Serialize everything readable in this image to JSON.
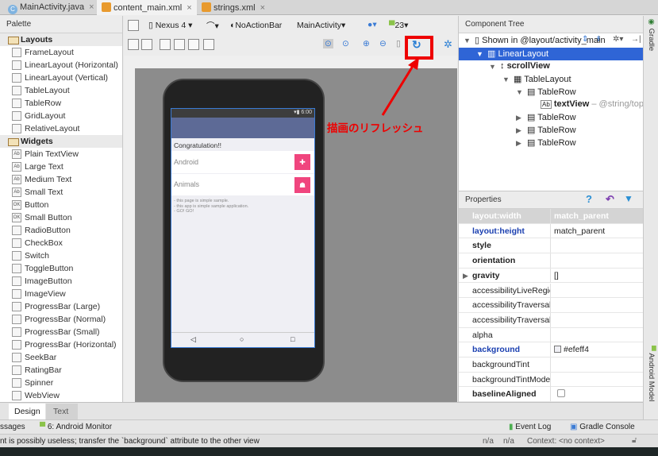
{
  "tabs": [
    {
      "label": "MainActivity.java",
      "icon": "C",
      "active": false
    },
    {
      "label": "content_main.xml",
      "icon": "xml",
      "active": true
    },
    {
      "label": "strings.xml",
      "icon": "xml",
      "active": false
    }
  ],
  "palette": {
    "title": "Palette",
    "sections": [
      {
        "label": "Layouts",
        "items": [
          "FrameLayout",
          "LinearLayout (Horizontal)",
          "LinearLayout (Vertical)",
          "TableLayout",
          "TableRow",
          "GridLayout",
          "RelativeLayout"
        ]
      },
      {
        "label": "Widgets",
        "items": [
          "Plain TextView",
          "Large Text",
          "Medium Text",
          "Small Text",
          "Button",
          "Small Button",
          "RadioButton",
          "CheckBox",
          "Switch",
          "ToggleButton",
          "ImageButton",
          "ImageView",
          "ProgressBar (Large)",
          "ProgressBar (Normal)",
          "ProgressBar (Small)",
          "ProgressBar (Horizontal)",
          "SeekBar",
          "RatingBar",
          "Spinner",
          "WebView"
        ]
      }
    ]
  },
  "toolbar": {
    "device": "Nexus 4",
    "theme": "NoActionBar",
    "activity": "MainActivity",
    "api": "23"
  },
  "phone": {
    "time": "6:00",
    "title": "Congratulation!!",
    "rows": [
      "Android",
      "Animals"
    ],
    "notes": [
      "- this page is simple sample.",
      "- this app is  simple sample application.",
      "- GO! GO!"
    ]
  },
  "annotation": "描画のリフレッシュ",
  "tree": {
    "title": "Component Tree",
    "shown_in": "Shown in @layout/activity_main",
    "nodes": [
      "LinearLayout",
      "scrollView",
      "TableLayout",
      "TableRow",
      "textView",
      "TableRow",
      "TableRow",
      "TableRow"
    ],
    "textview_hint": "– @string/top_"
  },
  "properties": {
    "title": "Properties",
    "rows": [
      {
        "key": "layout:width",
        "value": "match_parent"
      },
      {
        "key": "layout:height",
        "value": "match_parent"
      },
      {
        "key": "style",
        "value": ""
      },
      {
        "key": "orientation",
        "value": ""
      },
      {
        "key": "gravity",
        "value": "[]"
      },
      {
        "key": "accessibilityLiveRegion",
        "value": ""
      },
      {
        "key": "accessibilityTraversalAfter",
        "value": ""
      },
      {
        "key": "accessibilityTraversalBefore",
        "value": ""
      },
      {
        "key": "alpha",
        "value": ""
      },
      {
        "key": "background",
        "value": "#efeff4"
      },
      {
        "key": "backgroundTint",
        "value": ""
      },
      {
        "key": "backgroundTintMode",
        "value": ""
      },
      {
        "key": "baselineAligned",
        "value": ""
      }
    ]
  },
  "side": {
    "gradle": "Gradle",
    "android_model": "Android Model"
  },
  "bottom_tabs": [
    "Design",
    "Text"
  ],
  "toolstrip": {
    "messages": "ssages",
    "monitor": "6: Android Monitor",
    "event_log": "Event Log",
    "gradle_console": "Gradle Console"
  },
  "status": {
    "message": "nt is possibly useless; transfer the `background` attribute to the other view",
    "na1": "n/a",
    "na2": "n/a",
    "context": "Context: <no context>"
  },
  "colors": {
    "selection": "#2f65d6",
    "accent": "#f0457e",
    "appbar": "#5d6a96",
    "annotation": "#e00000"
  }
}
